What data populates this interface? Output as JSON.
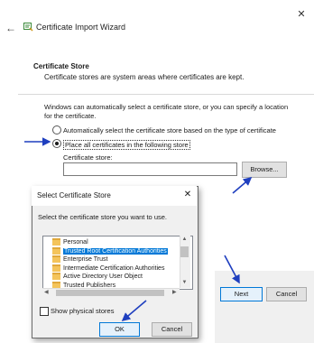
{
  "wizard": {
    "title": "Certificate Import Wizard",
    "close_glyph": "✕",
    "back_glyph": "←",
    "section_title": "Certificate Store",
    "section_subtitle": "Certificate stores are system areas where certificates are kept.",
    "description": "Windows can automatically select a certificate store, or you can specify a location for the certificate.",
    "radio_auto_label": "Automatically select the certificate store based on the type of certificate",
    "radio_auto_checked": false,
    "radio_place_label": "Place all certificates in the following store",
    "radio_place_checked": true,
    "store_label": "Certificate store:",
    "store_value": "",
    "browse_label": "Browse...",
    "next_label": "Next",
    "cancel_label": "Cancel"
  },
  "dialog": {
    "title": "Select Certificate Store",
    "close_glyph": "✕",
    "instruction": "Select the certificate store you want to use.",
    "stores": [
      {
        "label": "Personal",
        "selected": false
      },
      {
        "label": "Trusted Root Certification Authorities",
        "selected": true
      },
      {
        "label": "Enterprise Trust",
        "selected": false
      },
      {
        "label": "Intermediate Certification Authorities",
        "selected": false
      },
      {
        "label": "Active Directory User Object",
        "selected": false
      },
      {
        "label": "Trusted Publishers",
        "selected": false
      }
    ],
    "show_physical_label": "Show physical stores",
    "show_physical_checked": false,
    "ok_label": "OK",
    "cancel_label": "Cancel"
  },
  "colors": {
    "accent": "#0078d7",
    "annotation_arrow": "#1f3fbf",
    "folder": "#f4c45b"
  },
  "icons": [
    "back-arrow-icon",
    "certificate-wizard-icon",
    "close-icon",
    "folder-icon",
    "scroll-up-icon",
    "scroll-down-icon",
    "scroll-left-icon",
    "scroll-right-icon"
  ]
}
